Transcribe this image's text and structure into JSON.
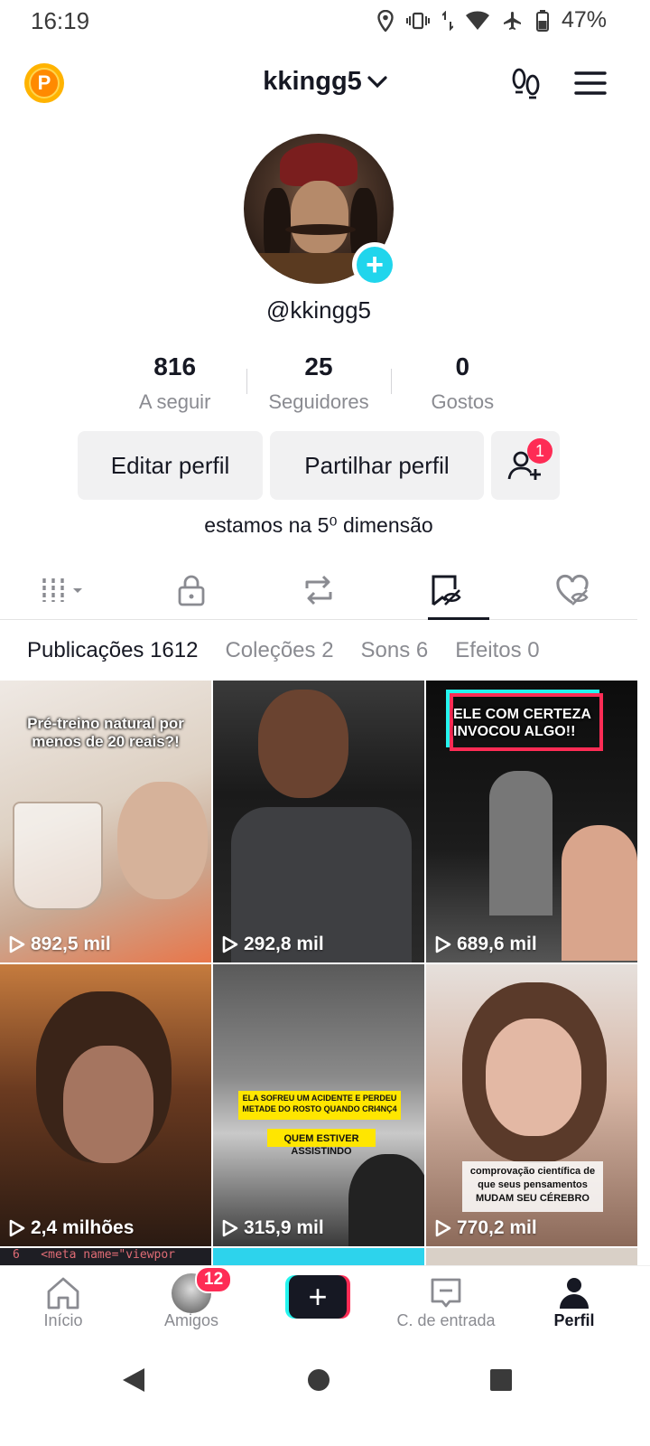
{
  "status": {
    "time": "16:19",
    "battery": "47%"
  },
  "header": {
    "username": "kkingg5"
  },
  "profile": {
    "handle": "@kkingg5",
    "stats": [
      {
        "num": "816",
        "label": "A seguir"
      },
      {
        "num": "25",
        "label": "Seguidores"
      },
      {
        "num": "0",
        "label": "Gostos"
      }
    ],
    "edit_label": "Editar perfil",
    "share_label": "Partilhar perfil",
    "friend_requests": "1",
    "bio": "estamos na 5⁰ dimensão"
  },
  "subtabs": [
    {
      "label": "Publicações 1612"
    },
    {
      "label": "Coleções 2"
    },
    {
      "label": "Sons 6"
    },
    {
      "label": "Efeitos 0"
    }
  ],
  "videos": [
    {
      "views": "892,5 mil",
      "caption": "Pré-treino natural por menos de 20 reais?!"
    },
    {
      "views": "292,8 mil",
      "caption": ""
    },
    {
      "views": "689,6 mil",
      "caption": "ELE COM CERTEZA INVOCOU ALGO!!"
    },
    {
      "views": "2,4 milhões",
      "caption": ""
    },
    {
      "views": "315,9 mil",
      "caption": "ELA SOFREU UM ACIDENTE E PERDEU METADE DO ROSTO QUANDO CRI4NÇ4",
      "caption2": "QUEM ESTIVER ASSISTINDO"
    },
    {
      "views": "770,2 mil",
      "caption": "comprovação científica de que seus pensamentos MUDAM SEU CÉREBRO"
    },
    {
      "code": "6   <meta name=\"viewpor"
    }
  ],
  "nav": {
    "home": "Início",
    "friends": "Amigos",
    "friends_badge": "12",
    "inbox": "C. de entrada",
    "profile": "Perfil"
  },
  "colors": {
    "accent": "#fe2c55",
    "cyan": "#25f4ee",
    "add": "#20d5ec"
  }
}
